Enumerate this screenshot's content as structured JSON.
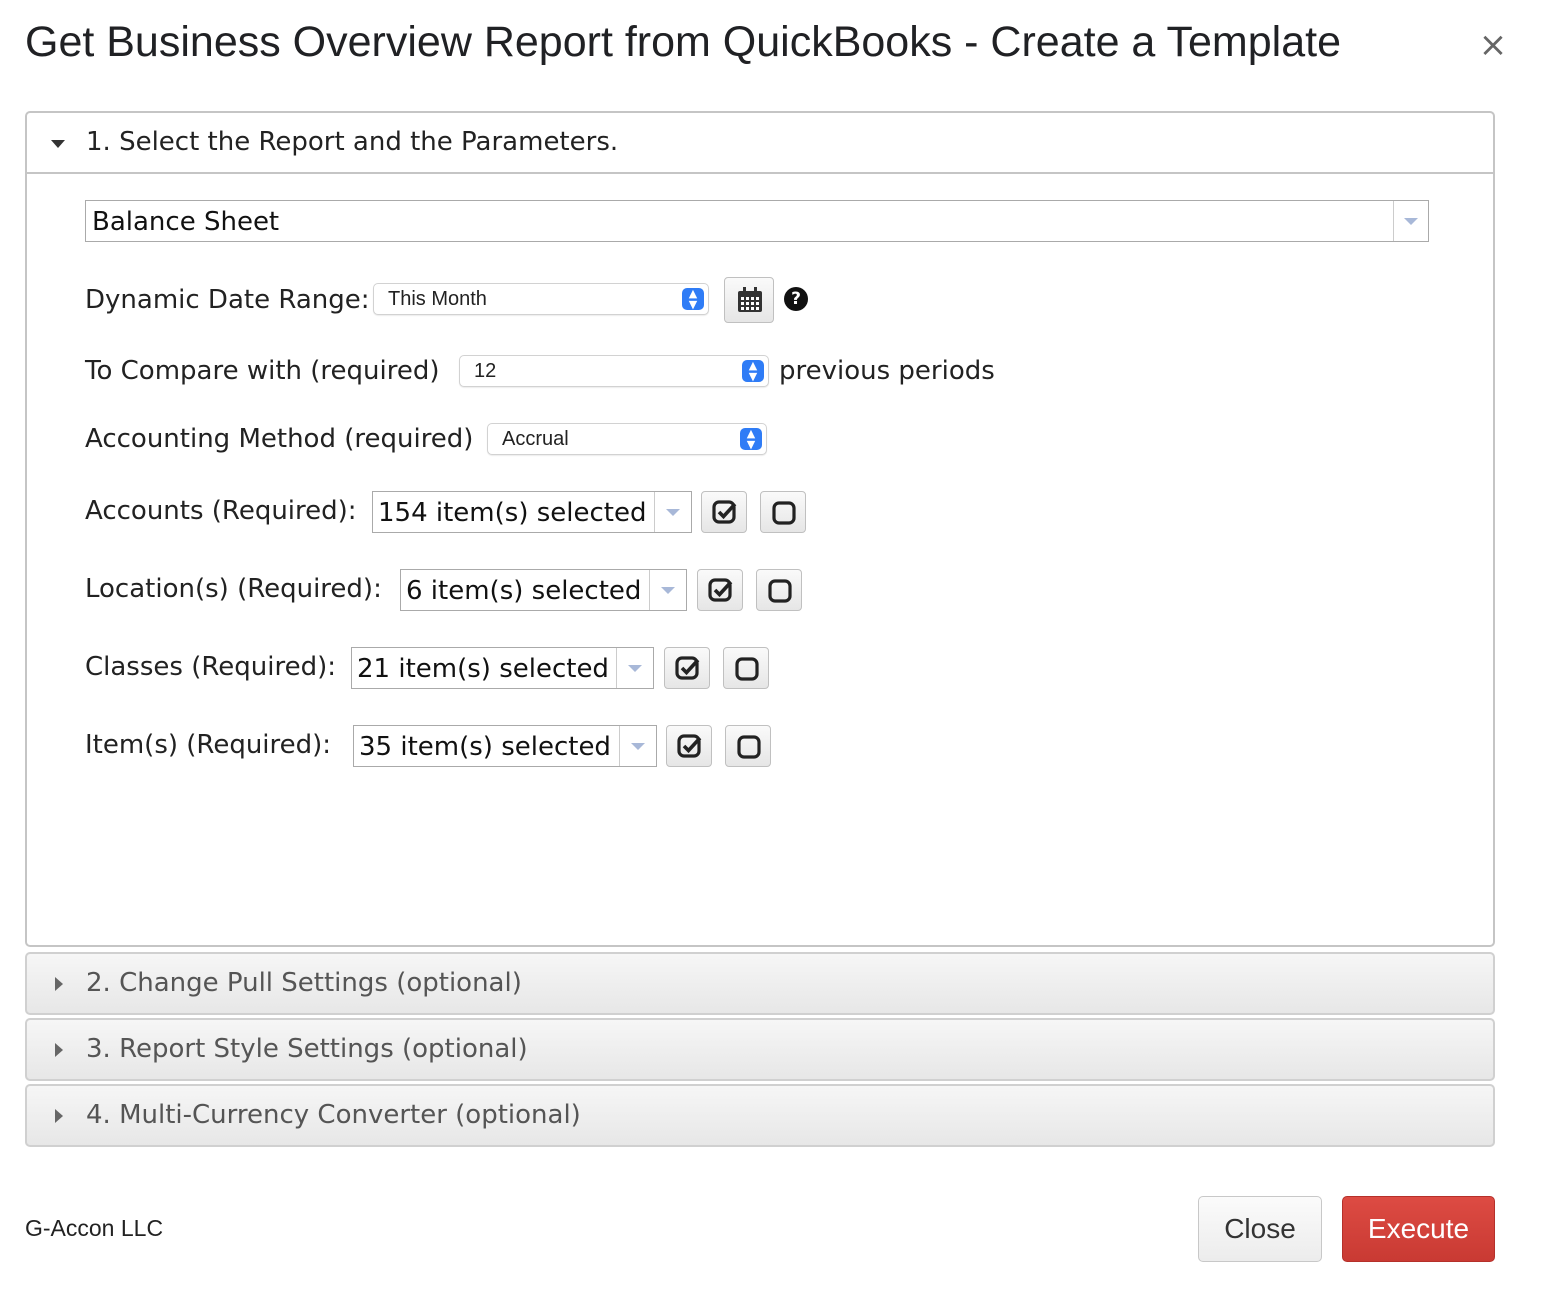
{
  "dialog": {
    "title": "Get Business Overview Report from QuickBooks - Create a Template",
    "close_glyph": "×"
  },
  "section1": {
    "label": "1. Select the Report and the Parameters.",
    "report": {
      "value": "Balance Sheet"
    },
    "date_range": {
      "label": "Dynamic Date Range:",
      "value": "This Month",
      "help_glyph": "?"
    },
    "compare": {
      "label": "To Compare with (required)",
      "value": "12",
      "suffix": "previous periods"
    },
    "accounting": {
      "label": "Accounting Method (required)",
      "value": "Accrual"
    },
    "accounts": {
      "label": "Accounts (Required):",
      "value": "154 item(s) selected"
    },
    "locations": {
      "label": "Location(s) (Required):",
      "value": "6 item(s) selected"
    },
    "classes": {
      "label": "Classes (Required):",
      "value": "21 item(s) selected"
    },
    "items": {
      "label": "Item(s) (Required):",
      "value": "35 item(s) selected"
    }
  },
  "sections": [
    {
      "label": "2. Change Pull Settings (optional)"
    },
    {
      "label": "3. Report Style Settings (optional)"
    },
    {
      "label": "4. Multi-Currency Converter (optional)"
    }
  ],
  "footer": {
    "brand": "G-Accon LLC",
    "close_label": "Close",
    "execute_label": "Execute"
  },
  "colors": {
    "execute_bg": "#d4413a",
    "select_chevron": "#2f7cf6"
  }
}
